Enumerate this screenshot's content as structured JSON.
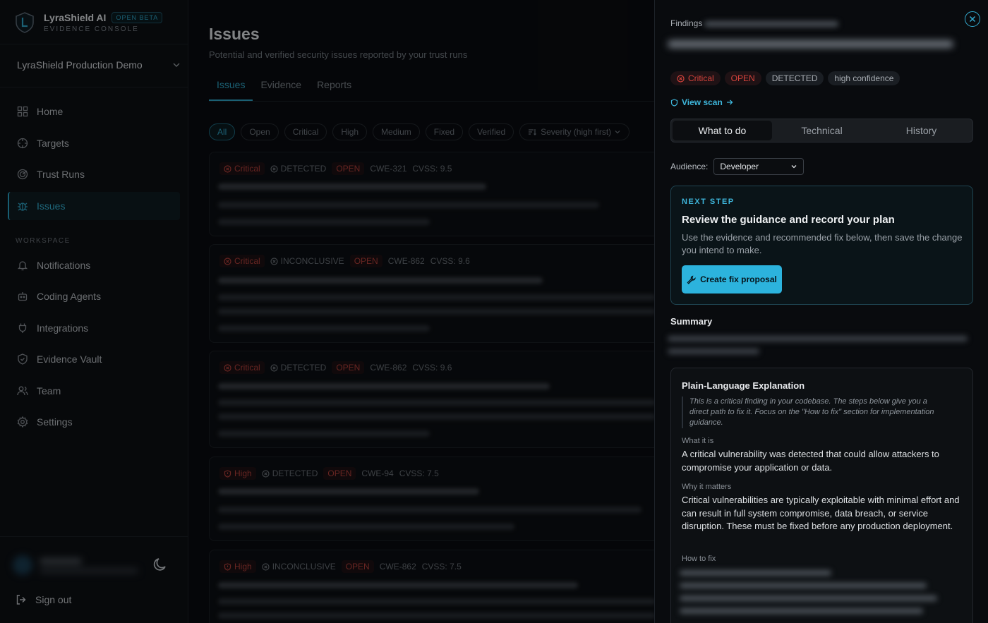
{
  "brand": {
    "name": "LyraShield AI",
    "beta": "OPEN BETA",
    "subtitle": "EVIDENCE CONSOLE"
  },
  "project": {
    "name": "LyraShield Production Demo"
  },
  "nav": {
    "home": "Home",
    "targets": "Targets",
    "trust_runs": "Trust Runs",
    "issues": "Issues",
    "workspace_label": "WORKSPACE",
    "notifications": "Notifications",
    "coding_agents": "Coding Agents",
    "integrations": "Integrations",
    "evidence_vault": "Evidence Vault",
    "team": "Team",
    "settings": "Settings",
    "sign_out": "Sign out"
  },
  "main": {
    "title": "Issues",
    "subtitle": "Potential and verified security issues reported by your trust runs",
    "tabs": [
      "Issues",
      "Evidence",
      "Reports"
    ],
    "filters": [
      "All",
      "Open",
      "Critical",
      "High",
      "Medium",
      "Fixed",
      "Verified"
    ],
    "sort": "Severity (high first)",
    "issues": [
      {
        "severity": "Critical",
        "status": "DETECTED",
        "state": "OPEN",
        "cwe": "CWE-321",
        "cvss": "CVSS: 9.5"
      },
      {
        "severity": "Critical",
        "status": "INCONCLUSIVE",
        "state": "OPEN",
        "cwe": "CWE-862",
        "cvss": "CVSS: 9.6"
      },
      {
        "severity": "Critical",
        "status": "DETECTED",
        "state": "OPEN",
        "cwe": "CWE-862",
        "cvss": "CVSS: 9.6"
      },
      {
        "severity": "High",
        "status": "DETECTED",
        "state": "OPEN",
        "cwe": "CWE-94",
        "cvss": "CVSS: 7.5"
      },
      {
        "severity": "High",
        "status": "INCONCLUSIVE",
        "state": "OPEN",
        "cwe": "CWE-862",
        "cvss": "CVSS: 7.5"
      }
    ]
  },
  "panel": {
    "findings_label": "Findings",
    "badges": {
      "severity": "Critical",
      "state": "OPEN",
      "status": "DETECTED",
      "confidence": "high confidence"
    },
    "view_scan": "View scan",
    "tabs": [
      "What to do",
      "Technical",
      "History"
    ],
    "audience_label": "Audience:",
    "audience_value": "Developer",
    "next_step": {
      "label": "NEXT STEP",
      "title": "Review the guidance and record your plan",
      "desc": "Use the evidence and recommended fix below, then save the change you intend to make.",
      "button": "Create fix proposal"
    },
    "summary_title": "Summary",
    "explanation": {
      "title": "Plain-Language Explanation",
      "quote": "This is a critical finding in your codebase. The steps below give you a direct path to fix it. Focus on the \"How to fix\" section for implementation guidance.",
      "what_h": "What it is",
      "what_p": "A critical vulnerability was detected that could allow attackers to compromise your application or data.",
      "why_h": "Why it matters",
      "why_p": "Critical vulnerabilities are typically exploitable with minimal effort and can result in full system compromise, data breach, or service disruption. These must be fixed before any production deployment.",
      "how_h": "How to fix"
    }
  },
  "colors": {
    "accent": "#2cb3dd",
    "critical": "#d5433c",
    "background": "#0a0c10"
  }
}
